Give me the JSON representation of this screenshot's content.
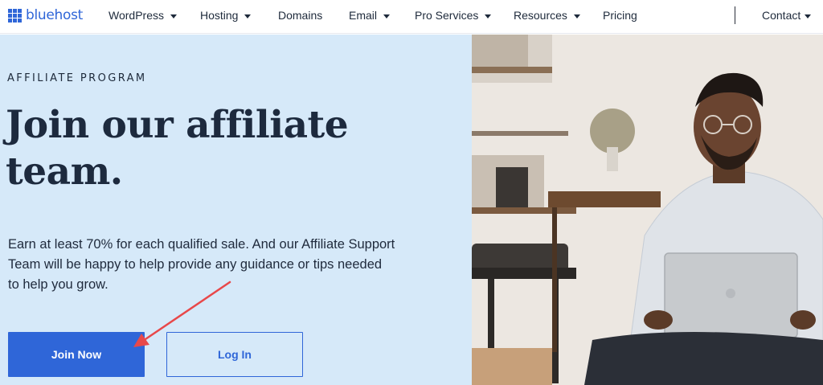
{
  "brand": {
    "name": "bluehost",
    "color": "#2f66d8"
  },
  "nav": {
    "items": [
      {
        "label": "WordPress",
        "has_dropdown": true
      },
      {
        "label": "Hosting",
        "has_dropdown": true
      },
      {
        "label": "Domains",
        "has_dropdown": false
      },
      {
        "label": "Email",
        "has_dropdown": true
      },
      {
        "label": "Pro Services",
        "has_dropdown": true
      },
      {
        "label": "Resources",
        "has_dropdown": true
      },
      {
        "label": "Pricing",
        "has_dropdown": false
      }
    ],
    "contact": {
      "label": "Contact",
      "has_dropdown": true
    }
  },
  "hero": {
    "eyebrow": "AFFILIATE PROGRAM",
    "headline_line1": "Join our affiliate",
    "headline_line2": "team.",
    "body_line1": "Earn at least 70% for each qualified sale. And our Affiliate Support",
    "body_line2": "Team will be happy to help provide any guidance or tips needed",
    "body_line3": "to help you grow.",
    "primary_button": "Join Now",
    "secondary_button": "Log In",
    "background_color": "#d6e9f9",
    "annotation_color": "#e8484a"
  },
  "photo": {
    "subject": "man-with-laptop-photo"
  }
}
